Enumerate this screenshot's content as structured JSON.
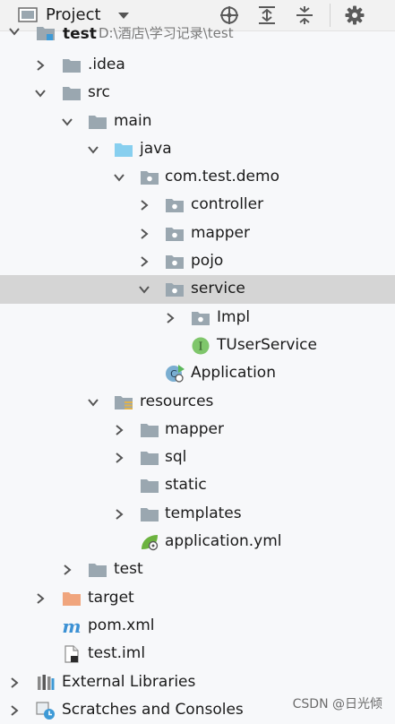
{
  "header": {
    "title": "Project",
    "view_icon": "project-view-icon",
    "caret_icon": "chevron-down-icon",
    "actions": [
      "locate-icon",
      "expand-all-icon",
      "collapse-all-icon",
      "gear-icon"
    ]
  },
  "tree": {
    "root": {
      "label": "test",
      "path": "D:\\酒店\\学习记录\\test"
    },
    "idea": "idea",
    "idea_label": ".idea",
    "src": "src",
    "main": "main",
    "java": "java",
    "pkg": "com.test.demo",
    "controller": "controller",
    "mapper": "mapper",
    "pojo": "pojo",
    "service": "service",
    "impl": "Impl",
    "tuserservice": "TUserService",
    "application": "Application",
    "resources": "resources",
    "res_mapper": "mapper",
    "sql": "sql",
    "static": "static",
    "templates": "templates",
    "application_yml": "application.yml",
    "test": "test",
    "target": "target",
    "pom": "pom.xml",
    "iml": "test.iml",
    "external_libraries": "External Libraries",
    "scratches": "Scratches and Consoles"
  },
  "colors": {
    "selection": "#d5d5d5",
    "folder_gray": "#9aa7b0",
    "folder_blue": "#87cfef",
    "folder_orange": "#f0a57d",
    "interface_green": "#7fc66b",
    "maven_blue": "#3c91d4"
  },
  "watermark": "CSDN @日光倾"
}
